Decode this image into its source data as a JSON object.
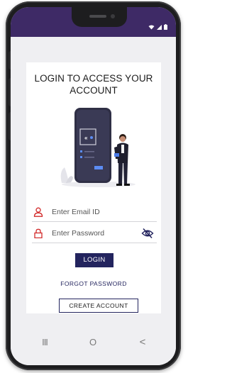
{
  "status_bar": {
    "icons": [
      "wifi-icon",
      "signal-icon",
      "battery-icon"
    ]
  },
  "login_card": {
    "title": "LOGIN TO ACCESS YOUR ACCOUNT",
    "email_placeholder": "Enter Email ID",
    "password_placeholder": "Enter Password",
    "login_label": "LOGIN",
    "forgot_label": "FORGOT PASSWORD",
    "create_label": "CREATE ACCOUNT"
  },
  "nav_bar": {
    "recents_glyph": "III",
    "home_glyph": "O",
    "back_glyph": "<"
  },
  "colors": {
    "status_bar": "#3e2a66",
    "primary_button": "#23245e",
    "field_icon": "#d22b2b",
    "screen_background": "#efeff2"
  }
}
